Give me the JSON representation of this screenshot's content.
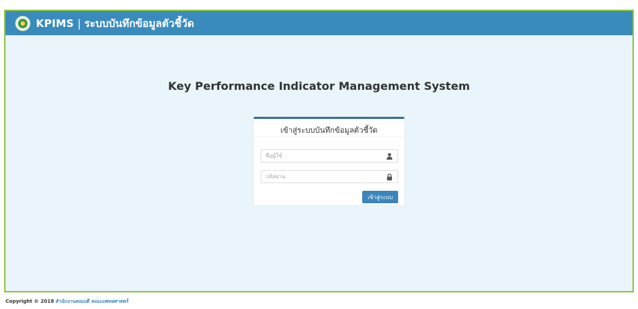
{
  "header": {
    "brand": "KPIMS",
    "separator": "|",
    "subtitle": "ระบบบันทึกข้อมูลตัวชี้วัด",
    "logo_icon": "university-seal-icon"
  },
  "main": {
    "heading": "Key Performance Indicator Management System"
  },
  "login": {
    "title": "เข้าสู่ระบบบันทึกข้อมูลตัวชี้วัด",
    "username_placeholder": "ชื่อผู้ใช้",
    "username_icon": "user-icon",
    "password_placeholder": "รหัสผ่าน",
    "password_icon": "lock-icon",
    "submit_label": "เข้าสู่ระบบ"
  },
  "footer": {
    "copyright": "Copyright © 2018",
    "org_link": "สำนักงานคณบดี คณะแพทยศาสตร์"
  },
  "colors": {
    "navbar": "#3a8bbd",
    "frame_border": "#8cc43c",
    "page_background": "#e9f5fb",
    "button": "#3a85bb",
    "panel_top_border": "#3a6f96"
  }
}
